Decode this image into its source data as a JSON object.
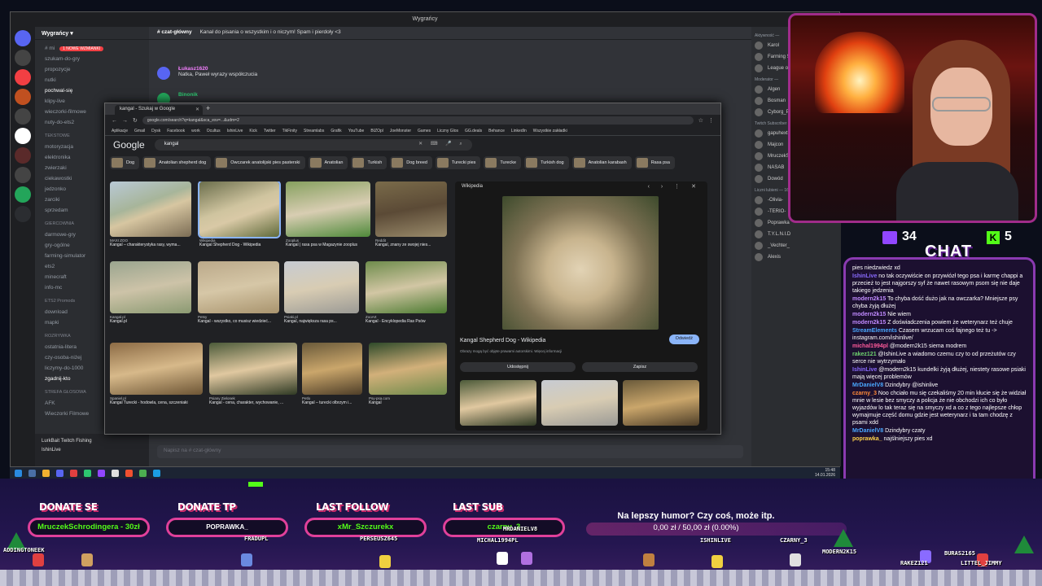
{
  "discord": {
    "window_title": "Wygrańcy",
    "guild_name": "Wygrańcy",
    "unread_badge": "1 NOWE WZMIANKI",
    "channels": [
      "szukam-do-gry",
      "propozycje",
      "nutki",
      "pochwal-się",
      "klipy-live",
      "wieczorki-filmowe",
      "nuty-do-ets2",
      "TEKSTOWE",
      "motoryzacja",
      "elektronika",
      "zwierzaki",
      "ciekawostki",
      "jedzonko",
      "zarciki",
      "sprzedam",
      "GIERCOWNIA",
      "darmowe-gry",
      "gry-ogólne",
      "farming-simulator",
      "ets2",
      "minecraft",
      "info-mc",
      "ETS2 Promods",
      "download",
      "mapki",
      "ROZRYWKA",
      "ostatnia-litera",
      "czy-osoba-niżej",
      "liczymy-do-1000",
      "zgadnij-kto",
      "STREFA GŁOSOWA",
      "AFK",
      "Wieczorki Filmowe"
    ],
    "active_channel": "czat-główny",
    "channel_desc": "Kanał do pisania o wszystkim i o niczym! Spam i pierdoły <3",
    "messages": [
      {
        "author": "Łukasz1620",
        "text": "Natka, Paweł wyrazy współczucia"
      },
      {
        "author": "Binonik",
        "text": ""
      }
    ],
    "chat_placeholder": "Napisz na # czat-główny",
    "member_groups": [
      "Aktywność —",
      "Moderator —",
      "Twitch Subscriber — 8",
      "Liczni lubieni — 16"
    ],
    "members": [
      "Karol",
      "Farming Simu",
      "League of Le",
      "Algen",
      "Bosman",
      "Cyborg_PL",
      "gapuhext",
      "Majcon",
      "MruczekSchrodingera",
      "NASAB",
      "Dowód",
      "-Olivia-",
      "-TERIO-",
      "Poprawka",
      "T.Y.L.N.I.D",
      "_Vechter_",
      "Alexis"
    ],
    "user_name": "IshinLive",
    "activity": "LurkBait Twitch Fishing"
  },
  "taskbar": {
    "time": "15:48",
    "date": "14.01.2026"
  },
  "browser": {
    "tab_title": "kangal - Szukaj w Google",
    "url": "google.com/search?q=kangal&sca_esv=...&udm=2",
    "bookmarks": [
      "Aplikacje",
      "Gmail",
      "Dysk",
      "Facebook",
      "work",
      "Ocultus",
      "IshinLive",
      "Kick",
      "Twitter",
      "TikFinity",
      "Streamlabs",
      "Grafik",
      "YouTube",
      "BIZOpl",
      "JoeMonster",
      "Games",
      "Liczny Glos",
      "GG.deals",
      "Behance",
      "LinkedIn",
      "Wszystkie zakładki"
    ],
    "logo": "Google",
    "query": "kangal",
    "chips": [
      "Dog",
      "Anatolian shepherd dog",
      "Owczarek anatolijski pies pasterski",
      "Anatolian",
      "Turkish",
      "Dog breed",
      "Turecki pies",
      "Turecke",
      "Turkish dog",
      "Anatolian karabash",
      "Rasa psa"
    ],
    "results": [
      {
        "src": "MAXI ZOO",
        "cap": "Kangal – charakterystyka rasy, wyma..."
      },
      {
        "src": "Wikipedia",
        "cap": "Kangal Shepherd Dog - Wikipedia"
      },
      {
        "src": "Zooplus",
        "cap": "Kangal | rasa psa w Magazynie zooplus"
      },
      {
        "src": "Reddit",
        "cap": "Kangal, znany ze swojej nies..."
      },
      {
        "src": "Kangal.pl",
        "cap": "Kangal.pl"
      },
      {
        "src": "Petsy",
        "cap": "Kangal - wszystko, co musisz wiedzieć..."
      },
      {
        "src": "Psiaki.pl",
        "cap": "Kangal, największa rasa ps..."
      },
      {
        "src": "ZooArt",
        "cap": "Kangal - Encyklopedia Ras Psów"
      },
      {
        "src": "Spaniel.pl",
        "cap": "Kangal Turecki - hodowla, cena, szczeniaki"
      },
      {
        "src": "Psiany Zielonek",
        "cap": "Kangal - cena, charakter, wychowanie, ..."
      },
      {
        "src": "Petlo",
        "cap": "Kangal – turecki olbrzym i..."
      },
      {
        "src": "Psy-psa.com",
        "cap": "Kangal"
      }
    ],
    "detail": {
      "source": "Wikipedia",
      "title": "Kangal Shepherd Dog - Wikipedia",
      "note": "Obrazy mogą być objęte prawami autorskimi. Więcej informacji",
      "visit": "Odwiedź",
      "share": "Udostępnij",
      "save": "Zapisz"
    }
  },
  "overlay": {
    "twitch_viewers": "34",
    "kick_viewers": "5",
    "chat_title": "CHAT",
    "chat": [
      {
        "name": "",
        "text": "pies niedzwiedz xd",
        "color": "#ffffff"
      },
      {
        "name": "IshinLive",
        "text": "no tak oczywiście on przywiózł tego psa i karmę chappi a przecież to jest najgorszy syf że nawet rasowym psom się nie daje takiego jedzenia",
        "color": "#8a6bff"
      },
      {
        "name": "modern2k15",
        "text": "To chyba dość dużo jak na owczarka? Mniejsze psy chyba żyją dłużej",
        "color": "#c08aff"
      },
      {
        "name": "modern2k15",
        "text": "Nie wiem",
        "color": "#c08aff"
      },
      {
        "name": "modern2k15",
        "text": "Z doświadczenia powiem że weterynarz też chuje",
        "color": "#c08aff"
      },
      {
        "name": "StreamElements",
        "text": "Czasem wrzucam coś fajnego też tu -> instagram.com/ishinlive/",
        "color": "#4aa8ff"
      },
      {
        "name": "michal1994pl",
        "text": "@modern2k15 siema modrem",
        "color": "#ff5a9a"
      },
      {
        "name": "rakez121",
        "text": "@IshinLive a wiadomo czemu czy to od przeżutów czy serce nie wytrzymało",
        "color": "#6fd46f"
      },
      {
        "name": "IshinLive",
        "text": "@modern2k15 kundelki żyją dłużej, niestety rasowe psiaki mają więcej problemów",
        "color": "#8a6bff"
      },
      {
        "name": "MrDanielV8",
        "text": "Dzindybry @ishinlive",
        "color": "#4aa8ff"
      },
      {
        "name": "czarny_3",
        "text": "Noo chciało mu się czekaliśmy 20 min kłucie się że widział mnie w lesie bez smyczy a policja że nie obchodzi ich co było wyjazdów lo tak teraz się na smyczy xd a co z tego najlepsze chłop wymajmuje część domu gdzie jest weterynarz i ta tam chodzę z psami xdd",
        "color": "#ff8a3a"
      },
      {
        "name": "MrDanielV8",
        "text": "Dzindybry czaty",
        "color": "#4aa8ff"
      },
      {
        "name": "poprawka_",
        "text": "najślniejszy pies xd",
        "color": "#ffd24a"
      }
    ],
    "donate_se_label": "DONATE SE",
    "donate_se_value": "MruczekSchrodingera - 30zł",
    "donate_tp_label": "DONATE TP",
    "donate_tp_value": "POPRAWKA_",
    "last_follow_label": "LAST FOLLOW",
    "last_follow_value": "xMr_Szczurekx",
    "last_sub_label": "LAST SUB",
    "last_sub_value": "czarny_3",
    "goal_text": "Na lepszy humor? Czy coś, może itp.",
    "goal_value": "0,00 zł / 50,00 zł (0.00%)",
    "ground_names": [
      "ADDINGTONEEK",
      "FRADUPL",
      "PERSEUSZ645",
      "MRDANIELV8",
      "MICHAL1994PL",
      "ISHINLIVE",
      "CZARNY_3",
      "MODERN2K15",
      "RAKEZ121",
      "LITTEL_JIMMY",
      "BURAS2165"
    ]
  }
}
